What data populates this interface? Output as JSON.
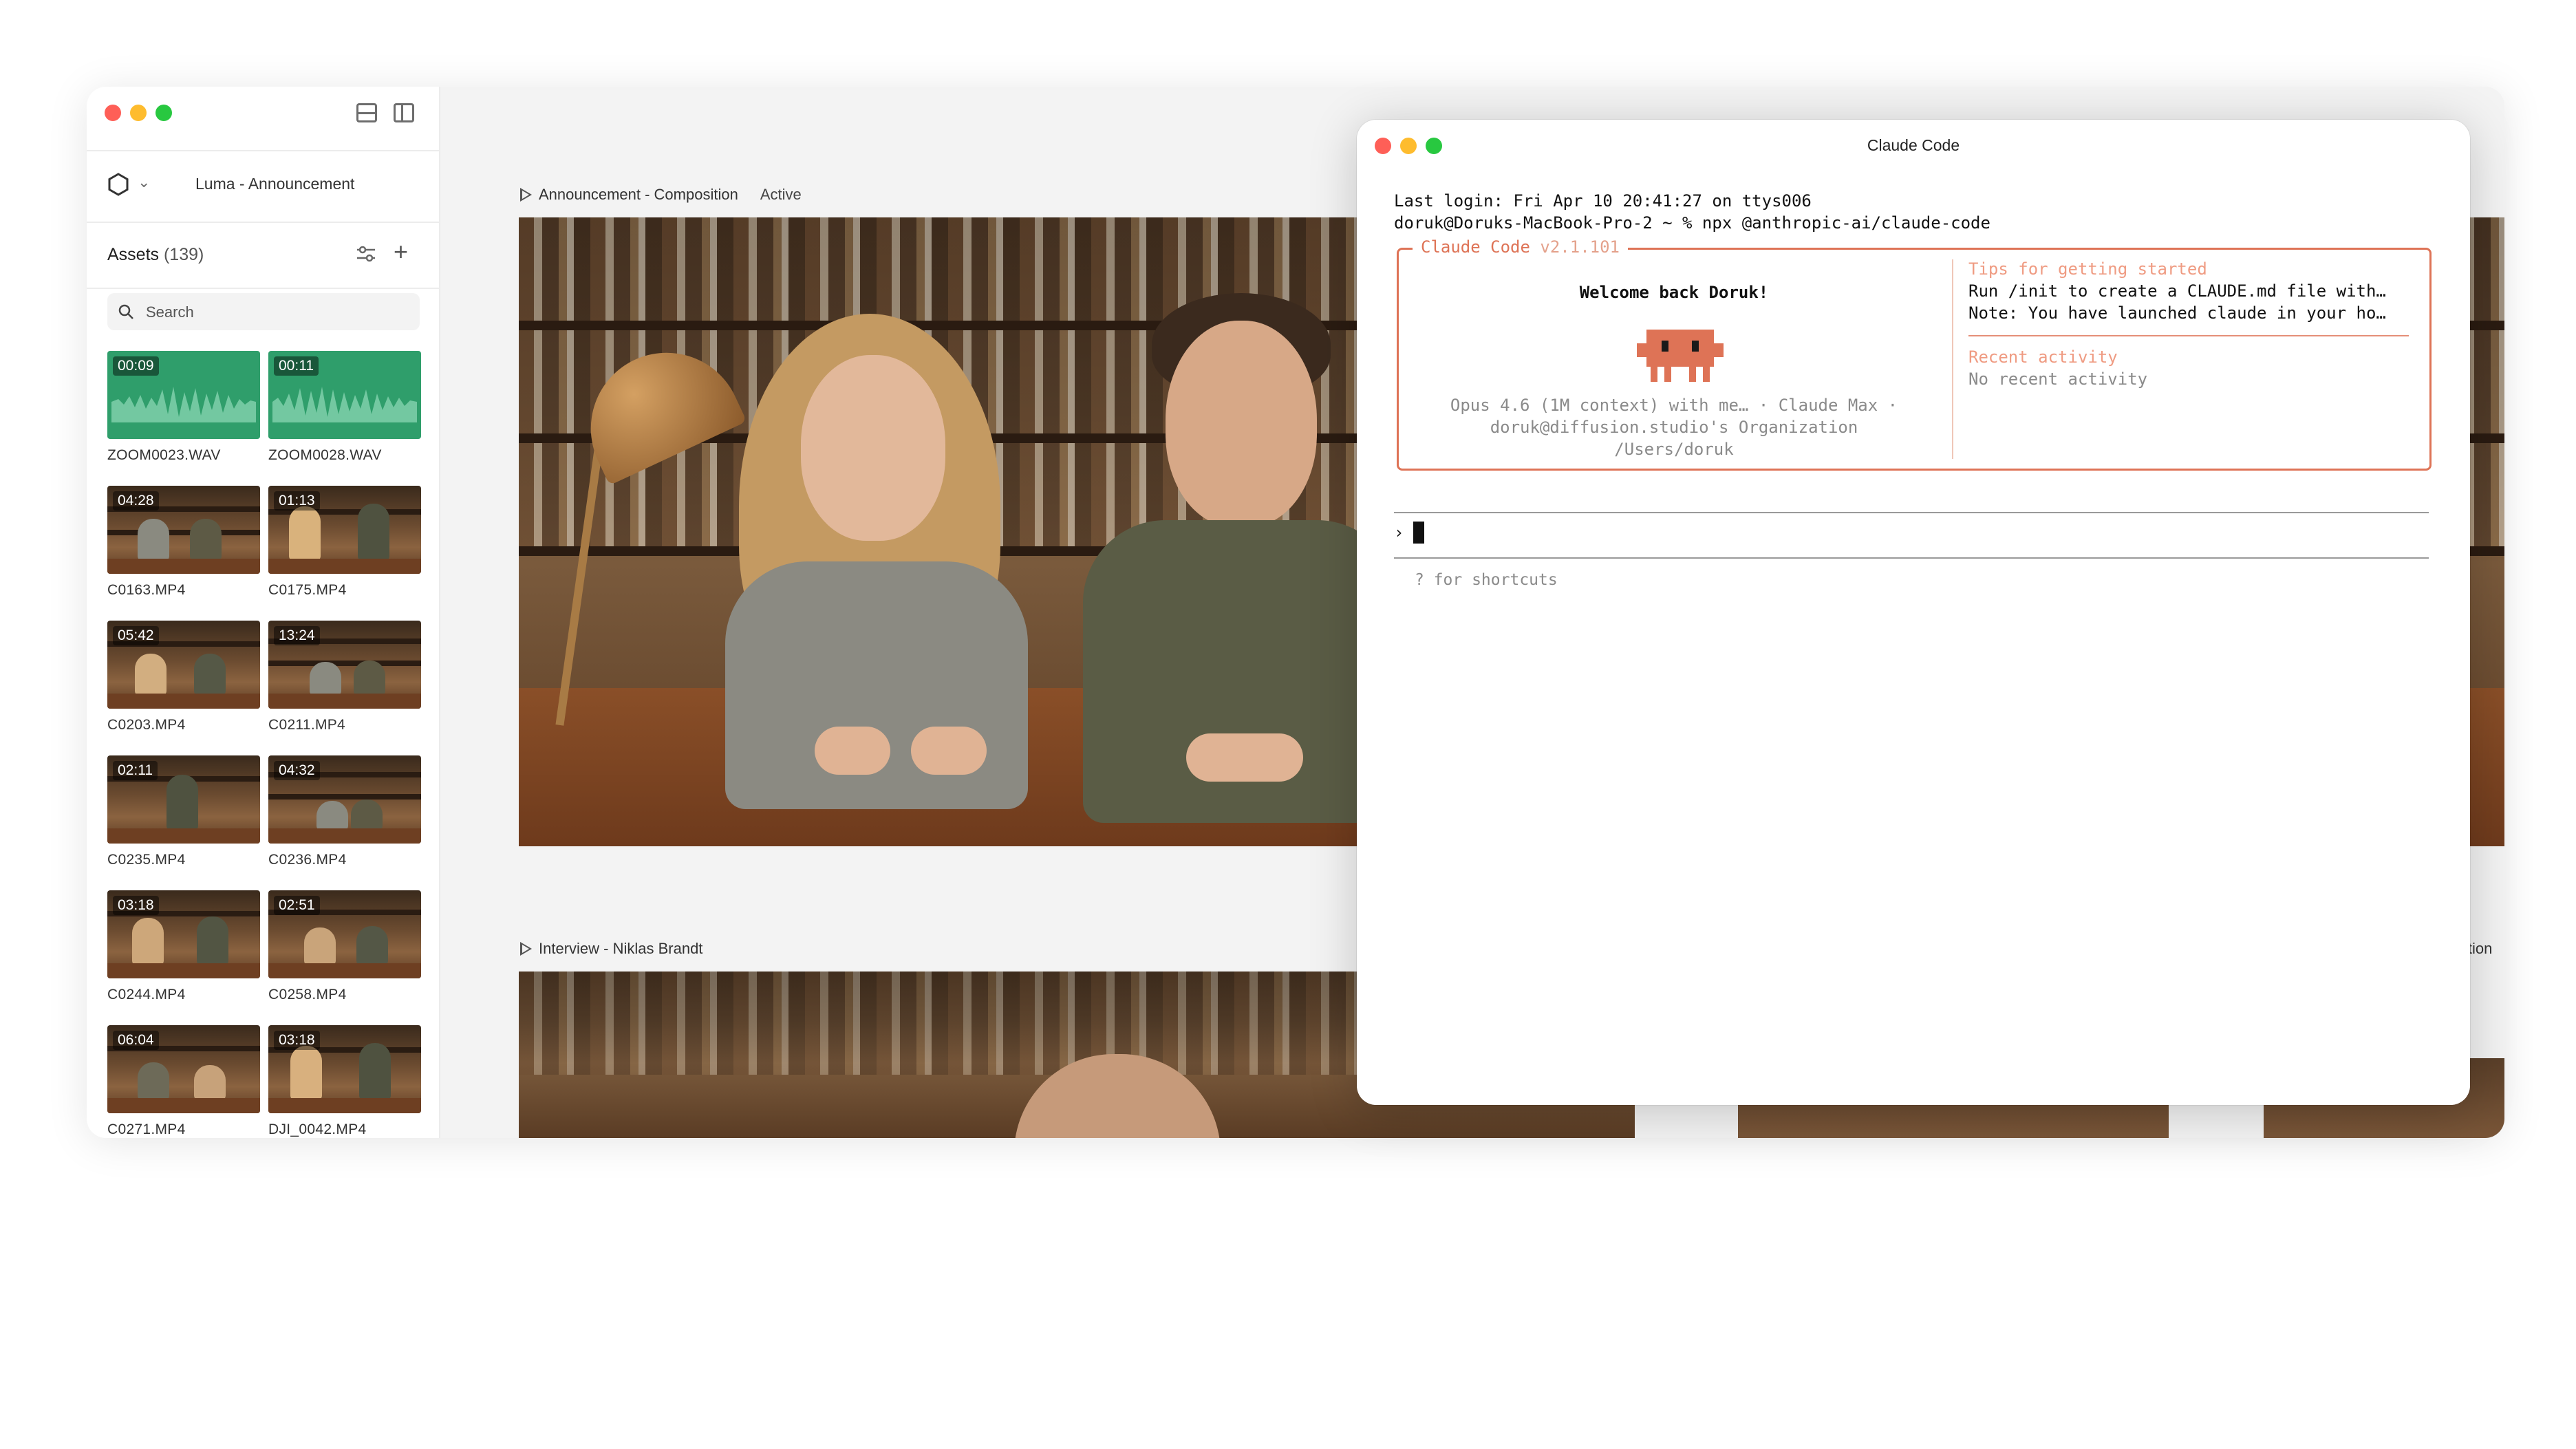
{
  "sidebar": {
    "project": "Luma - Announcement",
    "assets_title": "Assets",
    "assets_count": "(139)",
    "search_placeholder": "Search",
    "assets": [
      {
        "name": "ZOOM0023.WAV",
        "duration": "00:09",
        "kind": "audio"
      },
      {
        "name": "ZOOM0028.WAV",
        "duration": "00:11",
        "kind": "audio"
      },
      {
        "name": "C0163.MP4",
        "duration": "04:28",
        "kind": "video"
      },
      {
        "name": "C0175.MP4",
        "duration": "01:13",
        "kind": "video"
      },
      {
        "name": "C0203.MP4",
        "duration": "05:42",
        "kind": "video"
      },
      {
        "name": "C0211.MP4",
        "duration": "13:24",
        "kind": "video"
      },
      {
        "name": "C0235.MP4",
        "duration": "02:11",
        "kind": "video"
      },
      {
        "name": "C0236.MP4",
        "duration": "04:32",
        "kind": "video"
      },
      {
        "name": "C0244.MP4",
        "duration": "03:18",
        "kind": "video"
      },
      {
        "name": "C0258.MP4",
        "duration": "02:51",
        "kind": "video"
      },
      {
        "name": "C0271.MP4",
        "duration": "06:04",
        "kind": "video"
      },
      {
        "name": "DJI_0042.MP4",
        "duration": "03:18",
        "kind": "video"
      }
    ]
  },
  "main": {
    "composition_1": {
      "title": "Announcement - Composition",
      "status": "Active"
    },
    "composition_2": {
      "title": "Interview - Niklas Brandt"
    },
    "composition_3_partial": "ition"
  },
  "terminal": {
    "title": "Claude Code",
    "last_login": "Last login: Fri Apr 10 20:41:27 on ttys006",
    "command": "doruk@Doruks-MacBook-Pro-2 ~ % npx @anthropic-ai/claude-code",
    "box_legend_name": "Claude Code",
    "box_legend_version": "v2.1.101",
    "welcome": "Welcome back Doruk!",
    "model_line": "Opus 4.6 (1M context) with me… · Claude Max ·",
    "org_line": "doruk@diffusion.studio's Organization",
    "path_line": "/Users/doruk",
    "tips_title": "Tips for getting started",
    "tips_line_1": "Run /init to create a CLAUDE.md file with…",
    "tips_line_2": "Note: You have launched claude in your ho…",
    "recent_title": "Recent activity",
    "recent_body": "No recent activity",
    "prompt_symbol": "›",
    "shortcuts_hint": "? for shortcuts",
    "accent_color": "#de7356"
  },
  "colors": {
    "audio_thumb": "#2f9e6b",
    "traffic_red": "#fe5f57",
    "traffic_yellow": "#febc2e",
    "traffic_green": "#28c840"
  }
}
